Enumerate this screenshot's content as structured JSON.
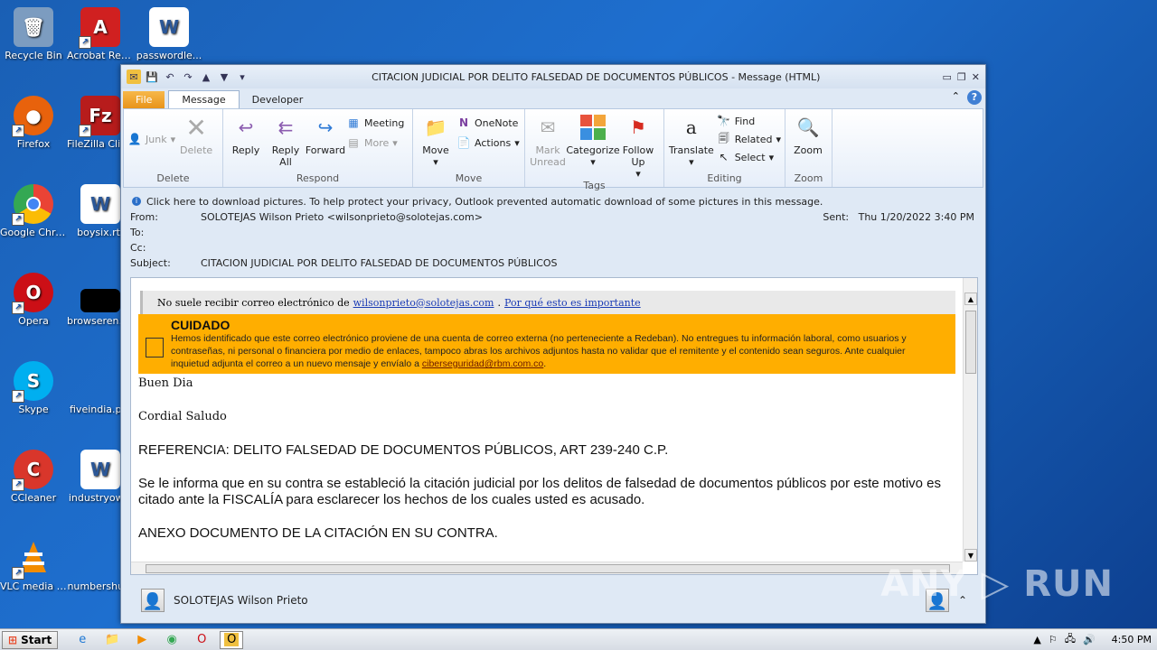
{
  "desktop": {
    "icons": [
      {
        "label": "Recycle Bin",
        "icon": "recycle-bin-icon",
        "color": "#6c8fb3"
      },
      {
        "label": "Acrobat Reader DC",
        "icon": "acrobat-icon",
        "color": "#d02020"
      },
      {
        "label": "passwordle...",
        "icon": "word-doc-icon",
        "color": "#2b5797"
      },
      {
        "label": "Firefox",
        "icon": "firefox-icon",
        "color": "#e8620c"
      },
      {
        "label": "FileZilla Client",
        "icon": "filezilla-icon",
        "color": "#b71c1c"
      },
      {
        "label": "Google Chrome",
        "icon": "chrome-icon",
        "color": "#34a853"
      },
      {
        "label": "boysix.rtf",
        "icon": "word-doc-icon",
        "color": "#2b5797"
      },
      {
        "label": "Opera",
        "icon": "opera-icon",
        "color": "#cc0f16"
      },
      {
        "label": "browsereng...",
        "icon": "black-file-icon",
        "color": "#000000"
      },
      {
        "label": "Skype",
        "icon": "skype-icon",
        "color": "#00aff0"
      },
      {
        "label": "fiveindia.p...",
        "icon": "blank-file-icon",
        "color": "#1e6fcf"
      },
      {
        "label": "CCleaner",
        "icon": "ccleaner-icon",
        "color": "#d9362b"
      },
      {
        "label": "industryow...",
        "icon": "word-doc-icon",
        "color": "#2b5797"
      },
      {
        "label": "VLC media player",
        "icon": "vlc-icon",
        "color": "#f28c00"
      },
      {
        "label": "numbershu...",
        "icon": "blank-file-icon",
        "color": "#1e6fcf"
      }
    ]
  },
  "window": {
    "title": "CITACION JUDICIAL POR DELITO FALSEDAD DE DOCUMENTOS PÚBLICOS  -  Message (HTML)",
    "tabs": {
      "file": "File",
      "message": "Message",
      "developer": "Developer"
    },
    "ribbon": {
      "delete_group": {
        "junk": "Junk",
        "delete": "Delete",
        "label": "Delete"
      },
      "respond_group": {
        "reply": "Reply",
        "reply_all": "Reply All",
        "forward": "Forward",
        "meeting": "Meeting",
        "more": "More",
        "label": "Respond"
      },
      "move_group": {
        "move": "Move",
        "onenote": "OneNote",
        "actions": "Actions",
        "label": "Move"
      },
      "tags_group": {
        "mark_unread": "Mark Unread",
        "categorize": "Categorize",
        "follow_up": "Follow Up",
        "label": "Tags"
      },
      "editing_group": {
        "translate": "Translate",
        "find": "Find",
        "related": "Related",
        "select": "Select",
        "label": "Editing"
      },
      "zoom_group": {
        "zoom": "Zoom",
        "label": "Zoom"
      }
    },
    "infobar": "Click here to download pictures. To help protect your privacy, Outlook prevented automatic download of some pictures in this message.",
    "header": {
      "from_label": "From:",
      "from": "SOLOTEJAS Wilson Prieto <wilsonprieto@solotejas.com>",
      "to_label": "To:",
      "cc_label": "Cc:",
      "subject_label": "Subject:",
      "subject": "CITACION JUDICIAL POR DELITO FALSEDAD DE DOCUMENTOS PÚBLICOS",
      "sent_label": "Sent:",
      "sent": "Thu 1/20/2022 3:40 PM"
    },
    "body": {
      "notice_text": "No suele recibir correo electrónico de",
      "notice_email": "wilsonprieto@solotejas.com",
      "notice_link": "Por qué esto es importante",
      "warning_title": "CUIDADO",
      "warning_text": "Hemos identificado que este correo electrónico proviene de una cuenta de correo externa (no perteneciente a Redeban). No entregues tu información laboral, como usuarios y contraseñas, ni personal o financiera por medio de enlaces, tampoco abras los archivos adjuntos hasta no validar que el remitente y el contenido sean seguros. Ante cualquier inquietud adjunta el correo a un nuevo mensaje y envíalo a",
      "warning_email": "ciberseguridad@rbm.com.co",
      "greeting": "Buen Dia",
      "closing": "Cordial Saludo",
      "reference": "REFERENCIA: DELITO FALSEDAD DE DOCUMENTOS PÚBLICOS, ART 239-240 C.P.",
      "paragraph": "Se le informa que en su contra se estableció la citación judicial por los delitos de falsedad de documentos públicos por este motivo es citado ante la FISCALÍA para esclarecer los hechos de los cuales usted es acusado.",
      "annex": "ANEXO DOCUMENTO DE LA CITACIÓN EN SU CONTRA."
    },
    "people_pane": {
      "name": "SOLOTEJAS Wilson Prieto"
    }
  },
  "taskbar": {
    "start": "Start",
    "clock": "4:50 PM"
  },
  "watermark": "ANY ▷ RUN"
}
